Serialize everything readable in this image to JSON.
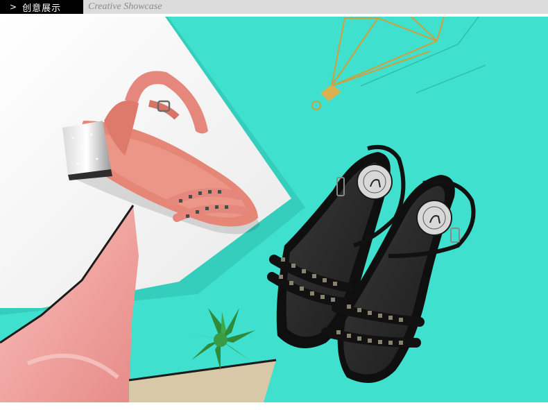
{
  "header": {
    "section_label": "创意展示",
    "chevron": ">",
    "subtitle": "Creative Showcase"
  },
  "photo": {
    "subject": "product-photo-sandals",
    "colors": {
      "background": "#3fe0cd",
      "board": "#ffffff",
      "pink_sandal": "#e5877c",
      "black_sandal": "#151515",
      "gold_frame": "#c9a245",
      "scarf": "#f0a9a6",
      "plant": "#2f8a3a"
    }
  }
}
